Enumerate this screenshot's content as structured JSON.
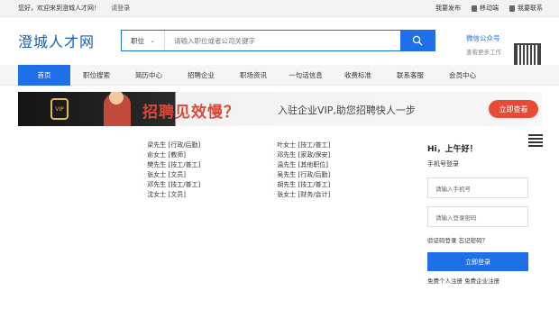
{
  "topbar": {
    "welcome": "您好，欢迎来到澄城人才网！",
    "login": "请登录",
    "publish": "我要发布",
    "mobile": "移动端",
    "contact": "我要联系"
  },
  "header": {
    "logo": "澄城人才网",
    "search_category": "职位",
    "search_placeholder": "请输入职位或者公司关键字",
    "wechat_title": "微信公众号",
    "wechat_sub": "查看更多工作"
  },
  "nav": [
    "首页",
    "职位搜索",
    "简历中心",
    "招聘企业",
    "职场资讯",
    "一句话信息",
    "收费标准",
    "联系客服",
    "会员中心"
  ],
  "banner": {
    "vip_label": "VIP",
    "headline": "招聘见效慢？",
    "subline": "入驻企业VIP,助您招聘快人一步",
    "cta": "立即查看"
  },
  "list_left": [
    "梁先生 [行政/后勤]",
    "俞女士 [教师]",
    "樊先生 [技工/普工]",
    "张女士 [文员]",
    "邓先生 [技工/普工]",
    "沈女士 [文员]"
  ],
  "list_right": [
    "叶女士 [技工/普工]",
    "邓先生 [家政/保安]",
    "温先生 [其他职位]",
    "吴先生 [行政/后勤]",
    "胡先生 [技工/普工]",
    "张女士 [财务/会计]"
  ],
  "login": {
    "greeting": "Hi，上午好！",
    "mode": "手机号登录",
    "phone_placeholder": "请输入手机号",
    "pwd_placeholder": "请输入登录密码",
    "links": "验证码登录 忘记密码？",
    "submit": "立即登录",
    "register": "免费个人注册 免费企业注册"
  }
}
